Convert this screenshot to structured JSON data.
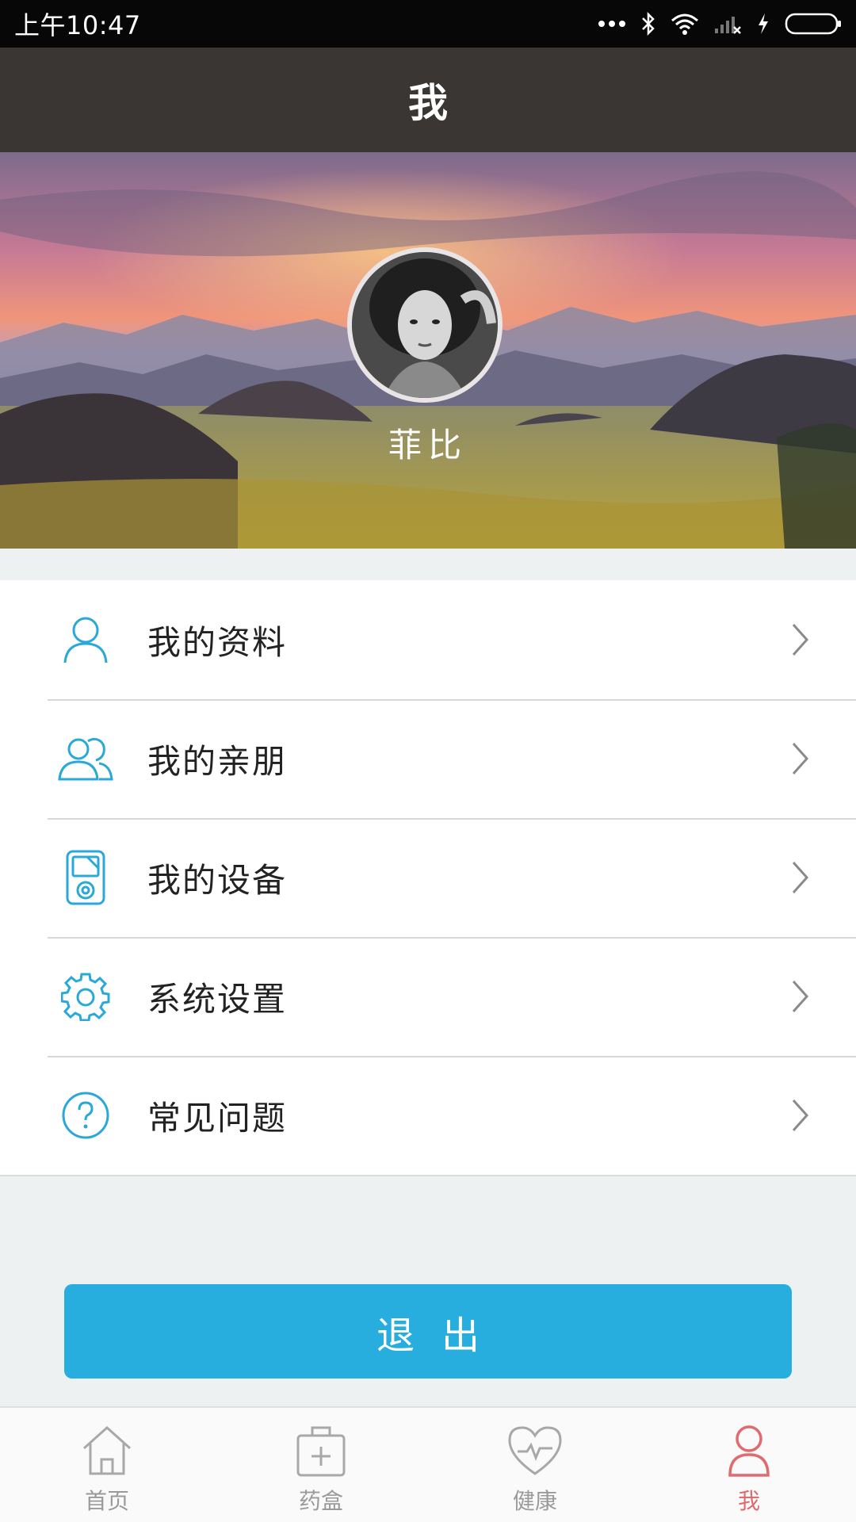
{
  "status_bar": {
    "time": "上午10:47"
  },
  "header": {
    "title": "我"
  },
  "profile": {
    "name": "菲比"
  },
  "menu": {
    "items": [
      {
        "label": "我的资料",
        "icon": "user-icon"
      },
      {
        "label": "我的亲朋",
        "icon": "friends-icon"
      },
      {
        "label": "我的设备",
        "icon": "device-icon"
      },
      {
        "label": "系统设置",
        "icon": "gear-icon"
      },
      {
        "label": "常见问题",
        "icon": "question-icon"
      }
    ]
  },
  "logout": {
    "label": "退出"
  },
  "bottom_nav": {
    "items": [
      {
        "label": "首页",
        "icon": "home-icon",
        "active": false
      },
      {
        "label": "药盒",
        "icon": "medicine-box-icon",
        "active": false
      },
      {
        "label": "健康",
        "icon": "heart-pulse-icon",
        "active": false
      },
      {
        "label": "我",
        "icon": "person-icon",
        "active": true
      }
    ]
  },
  "colors": {
    "accent": "#27aede",
    "icon_blue": "#2aa9d8",
    "active_nav": "#e06b6f",
    "header_bg": "#3a3633"
  }
}
